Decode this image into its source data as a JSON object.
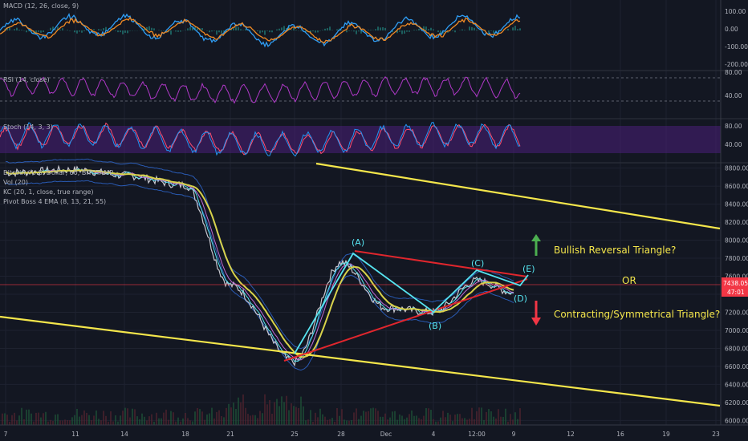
{
  "panes": {
    "macd": {
      "label": "MACD (12, 26, close, 9)",
      "ticks": [
        "100.00",
        "0.00",
        "-100.00",
        "-200.00"
      ]
    },
    "rsi": {
      "label": "RSI (14, close)",
      "ticks": [
        "80.00",
        "40.00"
      ]
    },
    "stoch": {
      "label": "Stoch (14, 3, 3)",
      "ticks": [
        "80.00",
        "40.00"
      ]
    },
    "main": {
      "labels": [
        "Bitcoin / U.S. Dollar, 60, BITSTAMP",
        "Vol (20)",
        "KC (20, 1, close, true range)",
        "Pivot Boss 4 EMA (8, 13, 21, 55)"
      ],
      "ticks": [
        "8800.00",
        "8600.00",
        "8400.00",
        "8200.00",
        "8000.00",
        "7800.00",
        "7600.00",
        "7400.00",
        "7200.00",
        "7000.00",
        "6800.00",
        "6600.00",
        "6400.00",
        "6200.00",
        "6000.00"
      ]
    }
  },
  "x_ticks": [
    "7",
    "11",
    "14",
    "18",
    "21",
    "25",
    "28",
    "Dec",
    "4",
    "12:00",
    "9",
    "12",
    "16",
    "19",
    "23"
  ],
  "price_badge": {
    "price": "7438.05",
    "countdown": "47:01",
    "color": "#f23645"
  },
  "annotations": {
    "waves": [
      "(A)",
      "(B)",
      "(C)",
      "(D)",
      "(E)"
    ],
    "bullish": "Bullish Reversal Triangle?",
    "or": "OR",
    "bearish": "Contracting/Symmetrical Triangle?"
  },
  "colors": {
    "background": "#131722",
    "yellow": "#f4e64b",
    "triangle": "#e0262d",
    "wave": "#56e4f0",
    "up_arrow": "#4caf50",
    "down_arrow": "#f23645",
    "macd": "#2f9df4",
    "signal": "#f08a24",
    "rsi": "#b038c8",
    "stoch_k": "#2196f3",
    "stoch_d": "#ff4d6d"
  },
  "chart_data": {
    "type": "line",
    "title": "Bitcoin / U.S. Dollar, 60, BITSTAMP",
    "ylim": [
      5950,
      8850
    ],
    "x": [
      "7",
      "11",
      "14",
      "18",
      "21",
      "25",
      "28",
      "Dec",
      "4",
      "12:00",
      "9"
    ],
    "series": [
      {
        "values": [
          8750,
          8780,
          8720,
          8610,
          7500,
          6650,
          7750,
          7250,
          7200,
          7550,
          7420
        ]
      }
    ],
    "triangle_points": {
      "A": 7800,
      "B": 7120,
      "C": 7620,
      "D": 7330,
      "E": 7600
    }
  }
}
